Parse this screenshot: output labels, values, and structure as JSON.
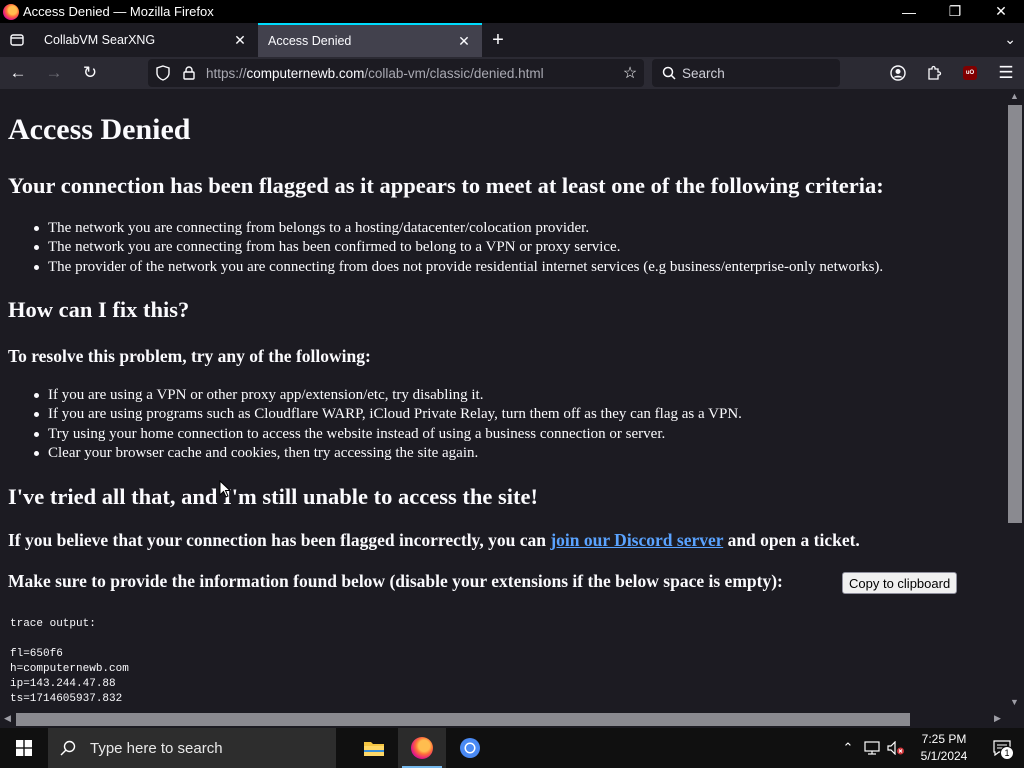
{
  "window": {
    "title": "Access Denied — Mozilla Firefox"
  },
  "tabs": [
    {
      "label": "CollabVM SearXNG",
      "active": false
    },
    {
      "label": "Access Denied",
      "active": true
    }
  ],
  "navbar": {
    "url_prefix": "https://",
    "url_host": "computernewb.com",
    "url_path": "/collab-vm/classic/denied.html",
    "search_placeholder": "Search"
  },
  "page": {
    "h1": "Access Denied",
    "h2_flagged": "Your connection has been flagged as it appears to meet at least one of the following criteria:",
    "criteria": [
      "The network you are connecting from belongs to a hosting/datacenter/colocation provider.",
      "The network you are connecting from has been confirmed to belong to a VPN or proxy service.",
      "The provider of the network you are connecting from does not provide residential internet services (e.g business/enterprise-only networks)."
    ],
    "h2_fix": "How can I fix this?",
    "h3_resolve": "To resolve this problem, try any of the following:",
    "fixes": [
      "If you are using a VPN or other proxy app/extension/etc, try disabling it.",
      "If you are using programs such as Cloudflare WARP, iCloud Private Relay, turn them off as they can flag as a VPN.",
      "Try using your home connection to access the website instead of using a business connection or server.",
      "Clear your browser cache and cookies, then try accessing the site again."
    ],
    "h2_tried": "I've tried all that, and I'm still unable to access the site!",
    "incorrect_prefix": "If you believe that your connection has been flagged incorrectly, you can ",
    "discord_link": "join our Discord server",
    "incorrect_suffix": " and open a ticket.",
    "provide_info": "Make sure to provide the information found below (disable your extensions if the below space is empty):",
    "copy_button": "Copy to clipboard",
    "trace_lines": [
      "trace output:",
      "",
      "fl=650f6",
      "h=computernewb.com",
      "ip=143.244.47.88",
      "ts=1714605937.832"
    ]
  },
  "taskbar": {
    "search_placeholder": "Type here to search",
    "time": "7:25 PM",
    "date": "5/1/2024",
    "notification_count": "1"
  },
  "colors": {
    "accent": "#00ddff",
    "link": "#5aa3ff",
    "page_bg": "#1c1b22"
  }
}
